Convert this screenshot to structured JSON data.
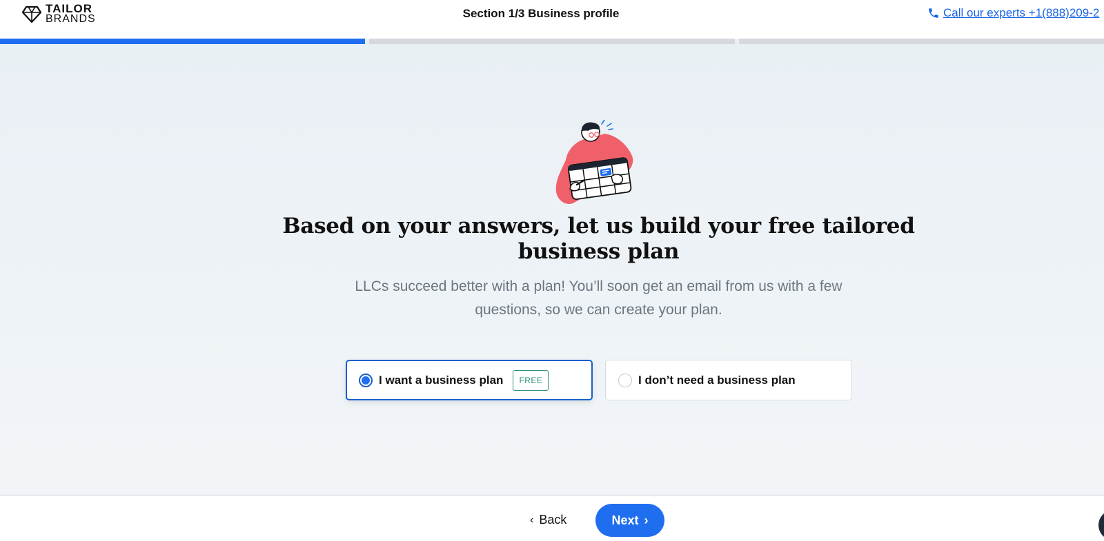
{
  "header": {
    "logo": {
      "line1": "TAILOR",
      "line2": "BRANDS"
    },
    "section_title": "Section 1/3 Business profile",
    "call_label": "Call our experts +1(888)209-2"
  },
  "progress": {
    "segments": 3,
    "current_segment_fill": 1.0,
    "completed_segments": 1
  },
  "main": {
    "headline_line1": "Based on your answers, let us build your free tailored",
    "headline_line2": "business plan",
    "subtitle_line1": "LLCs succeed better with a plan! You’ll soon get an email from us with a few",
    "subtitle_line2": "questions, so we can create your plan.",
    "options": [
      {
        "label": "I want a business plan",
        "badge": "FREE",
        "selected": true
      },
      {
        "label": "I don’t need a business plan",
        "selected": false
      }
    ]
  },
  "footer": {
    "back_label": "Back",
    "next_label": "Next"
  },
  "colors": {
    "accent": "#1f6ef0",
    "selected_border": "#1b5fc8",
    "badge": "#2b8f80",
    "illustration_shirt": "#f0606a"
  }
}
